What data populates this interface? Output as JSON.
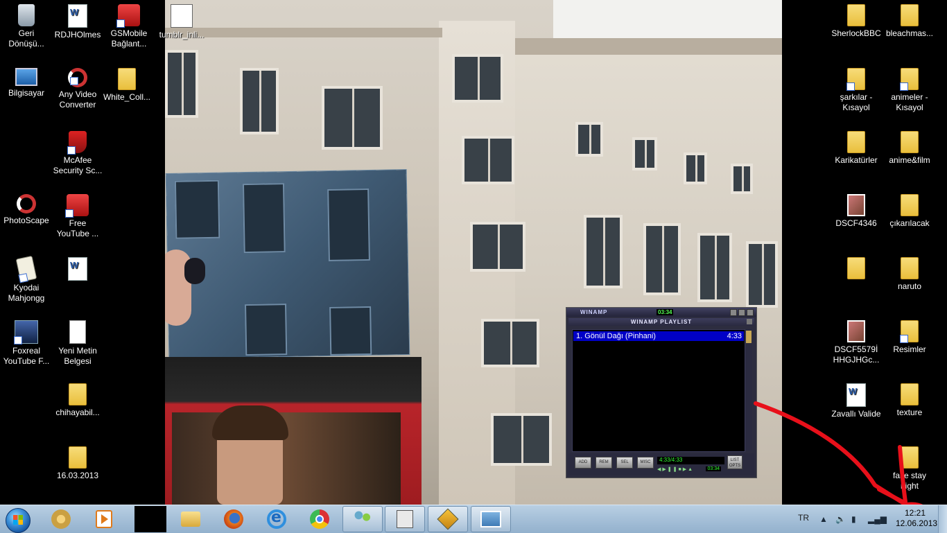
{
  "desktop": {
    "left_icons": [
      {
        "label": "Geri\nDönüşü...",
        "icon": "recycle-bin-icon"
      },
      {
        "label": "RDJHOlmes",
        "icon": "word-document-icon"
      },
      {
        "label": "GSMobile\nBağlant...",
        "icon": "gsmobile-icon"
      },
      {
        "label": "tumblr_inli...",
        "icon": "avatar-image-icon"
      },
      {
        "label": "Bilgisayar",
        "icon": "computer-icon"
      },
      {
        "label": "Any Video\nConverter",
        "icon": "video-converter-icon"
      },
      {
        "label": "White_Coll...",
        "icon": "folder-icon"
      },
      {
        "label": "McAfee\nSecurity Sc...",
        "icon": "mcafee-shield-icon"
      },
      {
        "label": "PhotoScape",
        "icon": "photoscape-icon"
      },
      {
        "label": "Free\nYouTube ...",
        "icon": "free-youtube-icon"
      },
      {
        "label": "Kyodai\nMahjongg",
        "icon": "mahjongg-icon"
      },
      {
        "label": "",
        "icon": "word-document-icon"
      },
      {
        "label": "Foxreal\nYouTube F...",
        "icon": "foxreal-icon"
      },
      {
        "label": "Yeni Metin\nBelgesi",
        "icon": "text-document-icon"
      },
      {
        "label": "chihayabil...",
        "icon": "folder-icon"
      },
      {
        "label": "16.03.2013",
        "icon": "folder-image-icon"
      }
    ],
    "right_icons": [
      {
        "label": "SherlockBBC",
        "icon": "folder-icon"
      },
      {
        "label": "bleachmas...",
        "icon": "folder-icon"
      },
      {
        "label": "şarkılar -\nKısayol",
        "icon": "folder-shortcut-icon"
      },
      {
        "label": "animeler -\nKısayol",
        "icon": "folder-shortcut-icon"
      },
      {
        "label": "Karikatürler",
        "icon": "folder-icon"
      },
      {
        "label": "anime&film",
        "icon": "folder-icon"
      },
      {
        "label": "DSCF4346",
        "icon": "image-file-icon"
      },
      {
        "label": "çıkarılacak",
        "icon": "folder-icon"
      },
      {
        "label": "",
        "icon": "folder-icon"
      },
      {
        "label": "naruto",
        "icon": "folder-icon"
      },
      {
        "label": "DSCF5579İ\nHHGJHGc...",
        "icon": "image-file-icon"
      },
      {
        "label": "Resimler",
        "icon": "folder-shortcut-icon"
      },
      {
        "label": "Zavallı Valide",
        "icon": "word-document-icon"
      },
      {
        "label": "texture",
        "icon": "folder-icon"
      },
      {
        "label": "fake stay\nnight",
        "icon": "folder-icon"
      }
    ]
  },
  "winamp": {
    "title": "WINAMP",
    "mini_time": "03:34",
    "playlist_title": "WINAMP PLAYLIST",
    "tracks": [
      {
        "name": "1. Gönül Dağı (Pinhani)",
        "duration": "4:33"
      }
    ],
    "buttons": {
      "add": "ADD",
      "rem": "REM",
      "sel": "SEL",
      "misc": "MISC",
      "list_opts": "LIST OPTS"
    },
    "position_display": "4:33/4:33",
    "elapsed": "03:34"
  },
  "taskbar": {
    "language": "TR",
    "clock_time": "12:21",
    "clock_date": "12.06.2013"
  },
  "colors": {
    "taskbar": "#a7c1d9",
    "playlist_selected": "#0000c6",
    "annotation": "#e8101a"
  }
}
